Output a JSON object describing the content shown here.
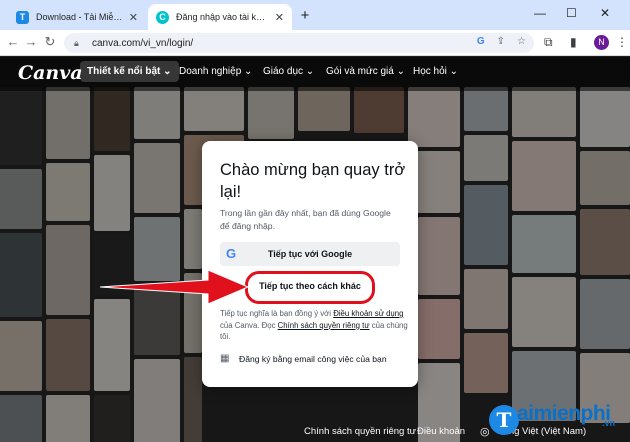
{
  "browser": {
    "tabs": [
      {
        "title": "Download - Tải Miễn Phí VN - P",
        "favicon": "T"
      },
      {
        "title": "Đăng nhập vào tài khoản Canva",
        "favicon": "C"
      }
    ],
    "url": "canva.com/vi_vn/login/",
    "profile_initial": "N"
  },
  "canva": {
    "logo": "Canva",
    "nav": [
      {
        "label": "Thiết kế nổi bật ⌄"
      },
      {
        "label": "Doanh nghiệp ⌄"
      },
      {
        "label": "Giáo dục ⌄"
      },
      {
        "label": "Gói và mức giá ⌄"
      },
      {
        "label": "Học hỏi ⌄"
      }
    ],
    "card": {
      "title": "Chào mừng bạn quay trở lại!",
      "subtitle": "Trong lần gần đây nhất, bạn đã dùng Google để đăng nhập.",
      "google_button": "Tiếp tục với Google",
      "other_button": "Tiếp tục theo cách khác",
      "terms_prefix": "Tiếp tục nghĩa là bạn đồng ý với ",
      "terms_link": "Điều khoản sử dụng",
      "terms_middle": " của Canva. Đọc ",
      "privacy_link": "Chính sách quyền riêng tư",
      "terms_suffix": " của chúng tôi.",
      "work_email": "Đăng ký bằng email công việc của bạn"
    },
    "footer": {
      "privacy": "Chính sách quyền riêng tư",
      "terms": "Điều khoản",
      "language": "Tiếng Việt (Việt Nam)"
    }
  },
  "watermark": {
    "brand": "aimienphi",
    "initial": "T",
    "tld": ".vn"
  },
  "colors": {
    "highlight": "#e0111c",
    "tab_bar": "#d3e3fd",
    "watermark": "#0b71c8"
  }
}
